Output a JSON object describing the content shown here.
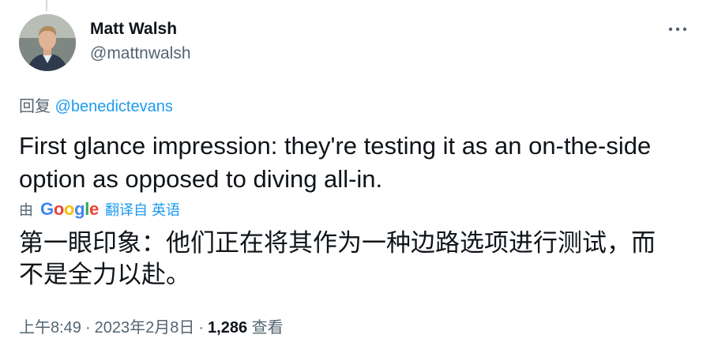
{
  "author": {
    "name": "Matt Walsh",
    "handle": "@mattnwalsh",
    "avatar": "avatar-photo"
  },
  "more_icon": "more-horizontal-icon",
  "reply": {
    "prefix": "回复",
    "mention": "@benedictevans"
  },
  "tweet": {
    "text": "First glance impression: they're testing it as an on-the-side option as opposed to diving all-in."
  },
  "translation": {
    "by_label": "由",
    "provider": "Google",
    "translated_from": "翻译自 英语",
    "text": "第一眼印象：他们正在将其作为一种边路选项进行测试，而不是全力以赴。"
  },
  "meta": {
    "time": "上午8:49",
    "date": "2023年2月8日",
    "separator": "·",
    "views_count": "1,286",
    "views_label": "查看"
  },
  "colors": {
    "text_primary": "#0f1419",
    "text_secondary": "#536471",
    "link": "#1d9bf0",
    "thread_line": "#cfd9de"
  }
}
